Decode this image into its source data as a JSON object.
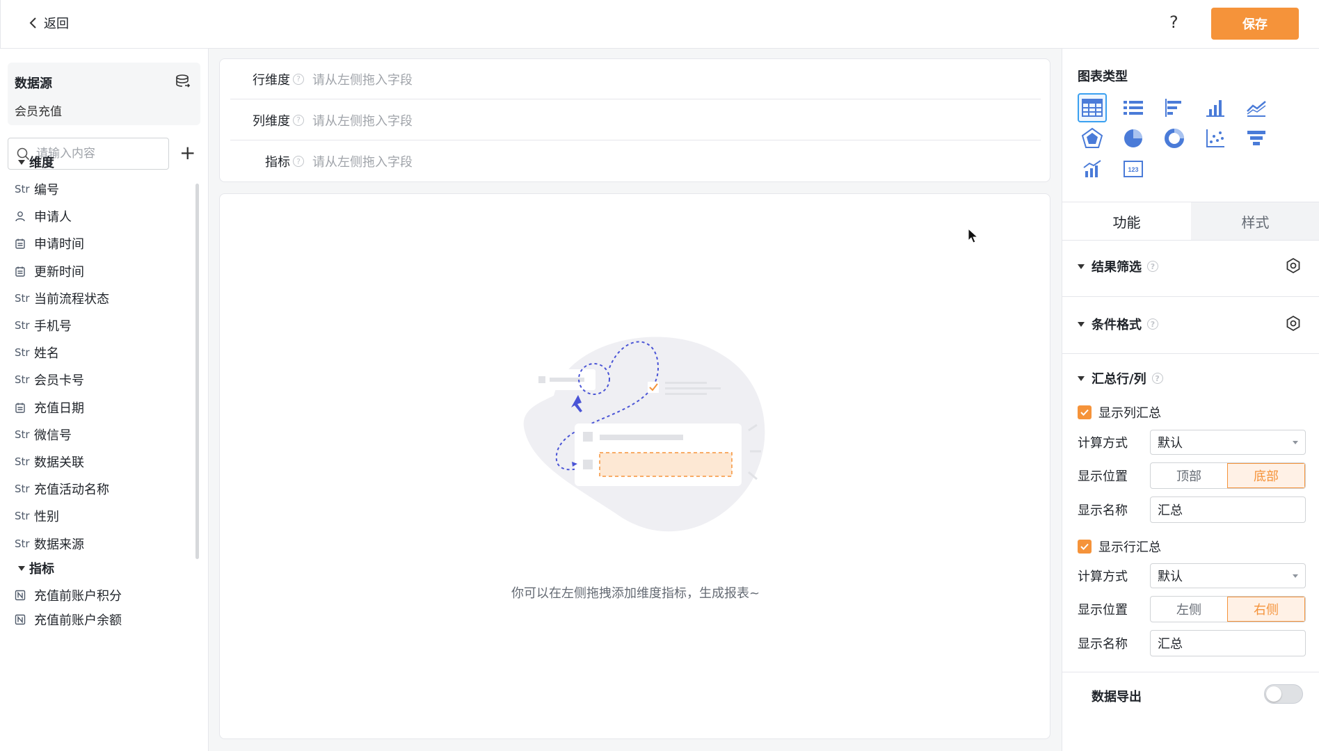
{
  "header": {
    "back_label": "返回",
    "help_label": "?",
    "save_label": "保存"
  },
  "datasource": {
    "title": "数据源",
    "name": "会员充值"
  },
  "search": {
    "placeholder": "请输入内容"
  },
  "dimension_group": "维度",
  "dimensions": [
    {
      "type": "Str",
      "label": "编号"
    },
    {
      "type": "user",
      "label": "申请人"
    },
    {
      "type": "date",
      "label": "申请时间"
    },
    {
      "type": "date",
      "label": "更新时间"
    },
    {
      "type": "Str",
      "label": "当前流程状态"
    },
    {
      "type": "Str",
      "label": "手机号"
    },
    {
      "type": "Str",
      "label": "姓名"
    },
    {
      "type": "Str",
      "label": "会员卡号"
    },
    {
      "type": "date",
      "label": "充值日期"
    },
    {
      "type": "Str",
      "label": "微信号"
    },
    {
      "type": "Str",
      "label": "数据关联"
    },
    {
      "type": "Str",
      "label": "充值活动名称"
    },
    {
      "type": "Str",
      "label": "性别"
    },
    {
      "type": "Str",
      "label": "数据来源"
    }
  ],
  "metric_group": "指标",
  "metrics": [
    {
      "type": "num",
      "label": "充值前账户积分"
    },
    {
      "type": "num",
      "label": "充值前账户余额"
    }
  ],
  "config_rows": [
    {
      "label": "行维度",
      "placeholder": "请从左侧拖入字段"
    },
    {
      "label": "列维度",
      "placeholder": "请从左侧拖入字段"
    },
    {
      "label": "指标",
      "placeholder": "请从左侧拖入字段"
    }
  ],
  "canvas": {
    "empty_text": "你可以在左侧拖拽添加维度指标，生成报表~"
  },
  "right_panel": {
    "chart_type_title": "图表类型",
    "chart_types": [
      "table-icon",
      "list-icon",
      "bar-horizontal-icon",
      "bar-vertical-icon",
      "line-icon",
      "radar-icon",
      "pie-icon",
      "donut-icon",
      "scatter-icon",
      "funnel-icon",
      "combo-icon",
      "number-card-icon"
    ],
    "tabs": [
      "功能",
      "样式"
    ],
    "sections": {
      "result_filter": "结果筛选",
      "conditional_format": "条件格式",
      "summary": "汇总行/列"
    },
    "col_summary": {
      "checkbox_label": "显示列汇总",
      "calc_label": "计算方式",
      "calc_value": "默认",
      "pos_label": "显示位置",
      "pos_options": [
        "顶部",
        "底部"
      ],
      "pos_selected": "底部",
      "name_label": "显示名称",
      "name_value": "汇总"
    },
    "row_summary": {
      "checkbox_label": "显示行汇总",
      "calc_label": "计算方式",
      "calc_value": "默认",
      "pos_label": "显示位置",
      "pos_options": [
        "左侧",
        "右侧"
      ],
      "pos_selected": "右侧",
      "name_label": "显示名称",
      "name_value": "汇总"
    },
    "data_export": {
      "label": "数据导出",
      "enabled": false
    }
  }
}
